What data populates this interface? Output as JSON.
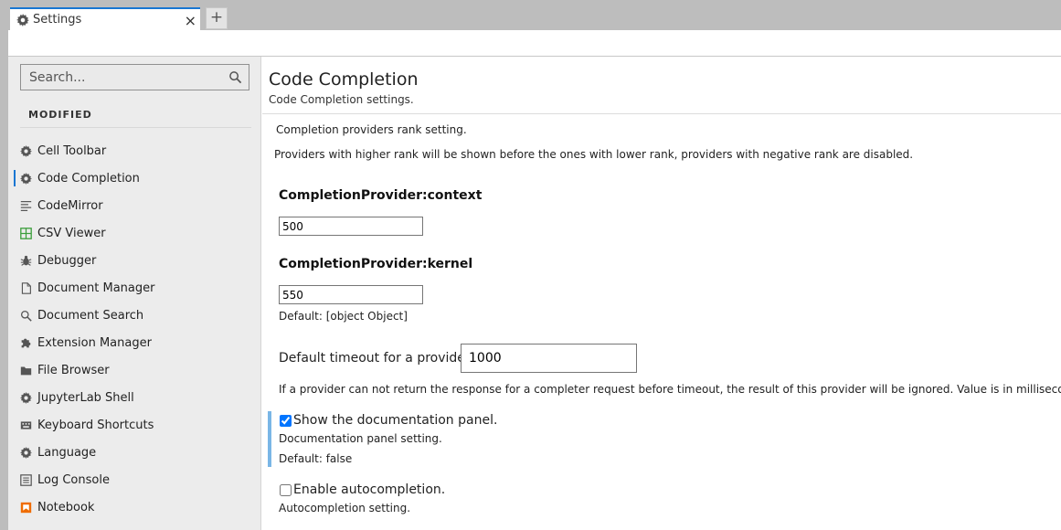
{
  "tab": {
    "title": "Settings",
    "close": "×",
    "new": "+"
  },
  "sidebar": {
    "search_placeholder": "Search...",
    "section": "MODIFIED",
    "items": [
      {
        "label": "Cell Toolbar",
        "icon": "gear-icon"
      },
      {
        "label": "Code Completion",
        "icon": "gear-icon",
        "active": true
      },
      {
        "label": "CodeMirror",
        "icon": "text-lines-icon"
      },
      {
        "label": "CSV Viewer",
        "icon": "grid-icon"
      },
      {
        "label": "Debugger",
        "icon": "bug-icon"
      },
      {
        "label": "Document Manager",
        "icon": "document-icon"
      },
      {
        "label": "Document Search",
        "icon": "search-icon"
      },
      {
        "label": "Extension Manager",
        "icon": "puzzle-icon"
      },
      {
        "label": "File Browser",
        "icon": "folder-icon"
      },
      {
        "label": "JupyterLab Shell",
        "icon": "gear-icon"
      },
      {
        "label": "Keyboard Shortcuts",
        "icon": "keyboard-icon"
      },
      {
        "label": "Language",
        "icon": "gear-icon"
      },
      {
        "label": "Log Console",
        "icon": "list-icon"
      },
      {
        "label": "Notebook",
        "icon": "notebook-icon"
      }
    ]
  },
  "main": {
    "title": "Code Completion",
    "subtitle": "Code Completion settings.",
    "rank_title": "Completion providers rank setting.",
    "rank_desc": "Providers with higher rank will be shown before the ones with lower rank, providers with negative rank are disabled.",
    "context_label": "CompletionProvider:context",
    "context_value": "500",
    "kernel_label": "CompletionProvider:kernel",
    "kernel_value": "550",
    "rank_default": "Default: [object Object]",
    "timeout_label": "Default timeout for a provider.",
    "timeout_value": "1000",
    "timeout_desc": "If a provider can not return the response for a completer request before timeout, the result of this provider will be ignored. Value is in millisecond",
    "doc_label": "Show the documentation panel.",
    "doc_checked": true,
    "doc_desc": "Documentation panel setting.",
    "doc_default": "Default: false",
    "auto_label": "Enable autocompletion.",
    "auto_checked": false,
    "auto_desc": "Autocompletion setting."
  },
  "colors": {
    "accent": "#1976d2",
    "modified_bar": "#7ab6e6"
  }
}
